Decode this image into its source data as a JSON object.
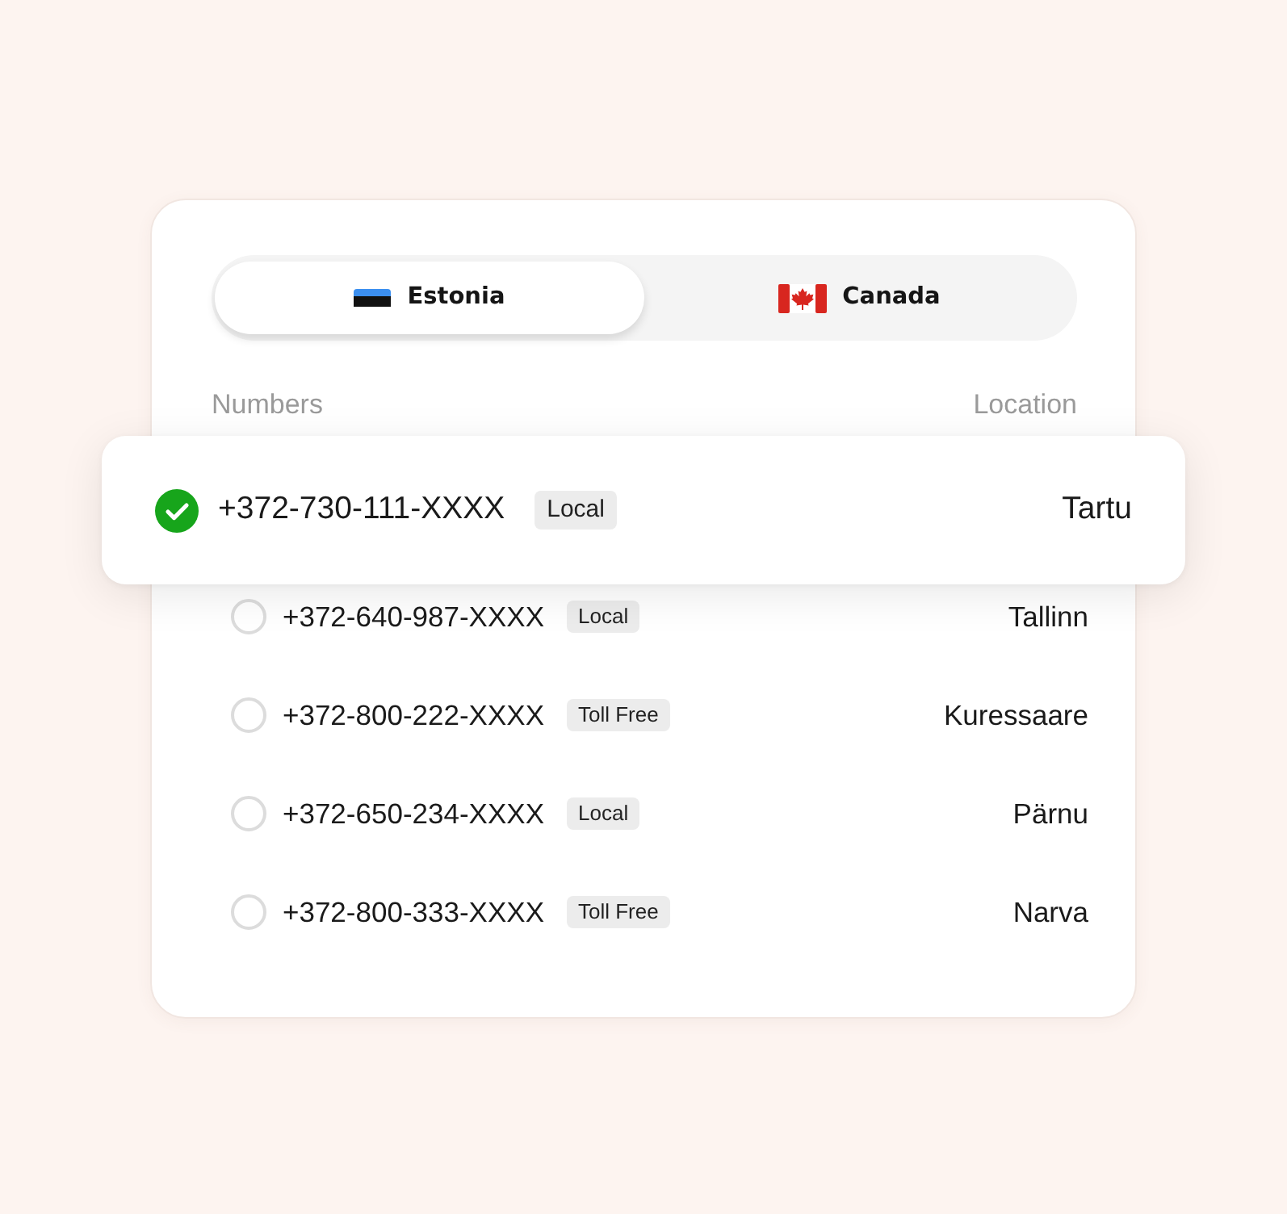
{
  "tabs": [
    {
      "label": "Estonia",
      "kind": "estonia",
      "selected": true
    },
    {
      "label": "Canada",
      "kind": "canada",
      "selected": false
    }
  ],
  "columns": [
    "Numbers",
    "Location"
  ],
  "rows": [
    {
      "number": "+372-730-111-XXXX",
      "type": "Local",
      "location": "Tartu",
      "selected": true
    },
    {
      "number": "+372-640-987-XXXX",
      "type": "Local",
      "location": "Tallinn",
      "selected": false
    },
    {
      "number": "+372-800-222-XXXX",
      "type": "Toll Free",
      "location": "Kuressaare",
      "selected": false
    },
    {
      "number": "+372-650-234-XXXX",
      "type": "Local",
      "location": "Pärnu",
      "selected": false
    },
    {
      "number": "+372-800-333-XXXX",
      "type": "Toll Free",
      "location": "Narva",
      "selected": false
    }
  ]
}
